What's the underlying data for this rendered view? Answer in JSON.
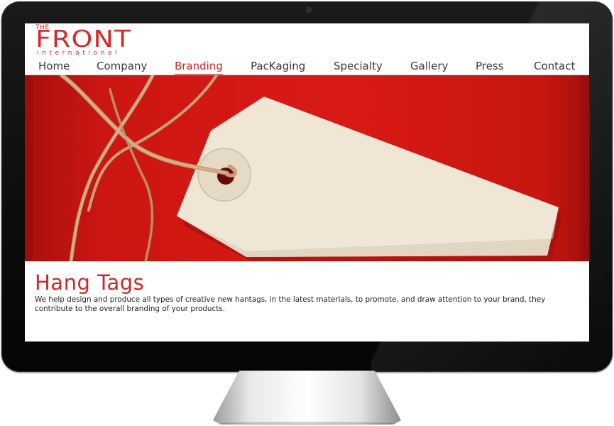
{
  "logo": {
    "top": "THE",
    "main": "FRONT",
    "sub": "international"
  },
  "nav": {
    "items": [
      {
        "label": "Home"
      },
      {
        "label": "Company"
      },
      {
        "label": "Branding"
      },
      {
        "label": "PacKaging"
      },
      {
        "label": "Specialty"
      },
      {
        "label": "Gallery"
      },
      {
        "label": "Press"
      },
      {
        "label": "Contact"
      }
    ],
    "active": "Branding"
  },
  "content": {
    "title": "Hang Tags",
    "body": "We help design and produce all types of creative new hantags, in the latest materials, to promote, and draw attention to your brand, they contribute to the overall branding of your products."
  },
  "colors": {
    "brand": "#d42a2a",
    "hero_background": "#d91a14",
    "tag": "#efe6d6",
    "twine": "#c9a27a"
  },
  "icons": {
    "camera": "webcam-dot"
  }
}
